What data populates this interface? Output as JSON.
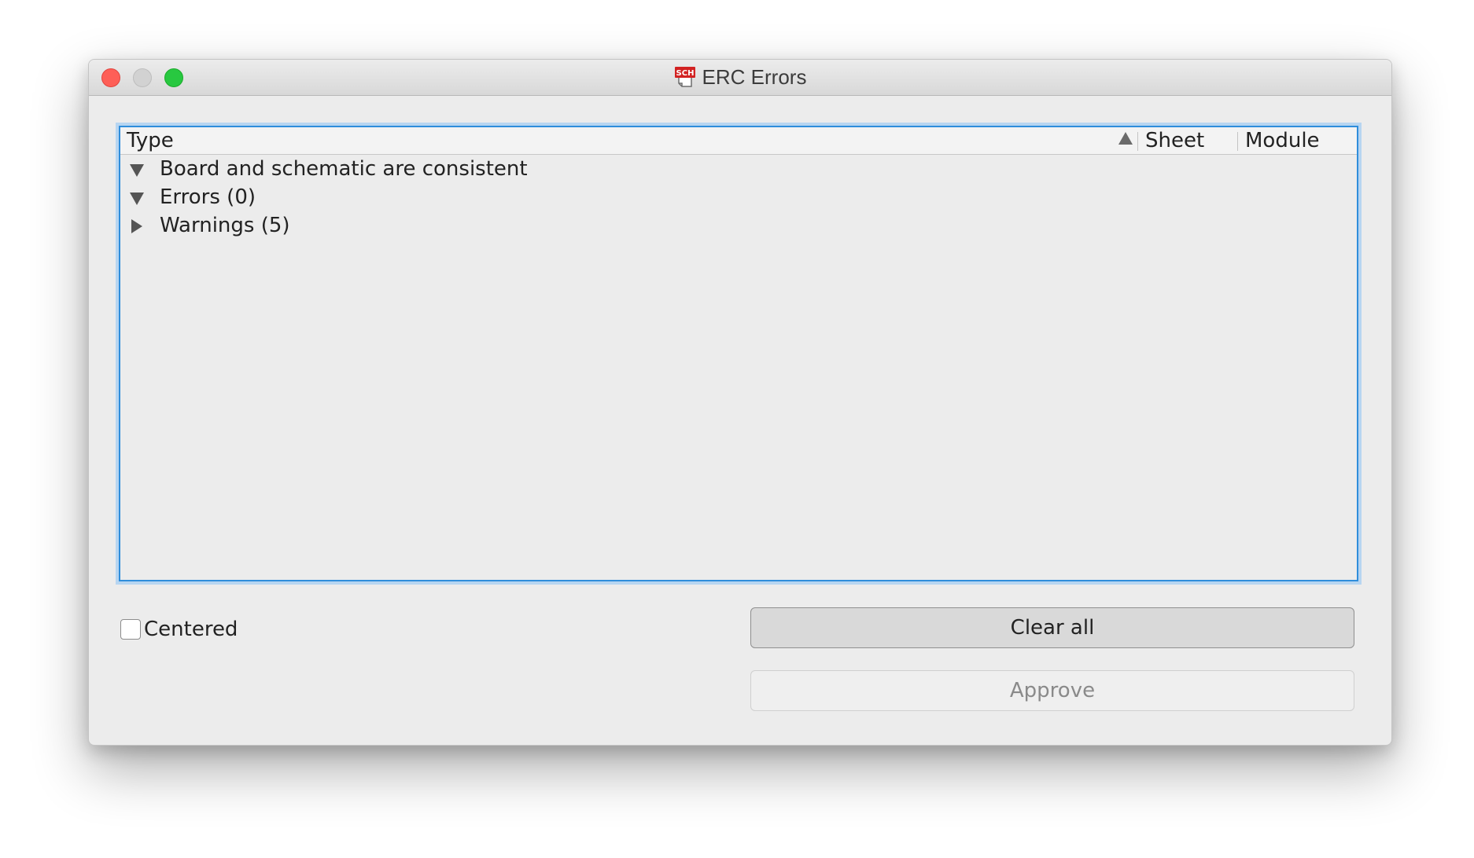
{
  "window": {
    "title": "ERC Errors",
    "app_icon": "schematic-sch-icon",
    "app_icon_text": "SCH",
    "traffic_lights": [
      "close",
      "minimize",
      "zoom"
    ]
  },
  "tree": {
    "columns": [
      "Type",
      "Sheet",
      "Module"
    ],
    "sort_column": "Type",
    "sort_direction": "ascending",
    "rows": [
      {
        "label": "Board and schematic are consistent",
        "expanded": true
      },
      {
        "label": "Errors (0)",
        "expanded": true
      },
      {
        "label": "Warnings (5)",
        "expanded": false
      }
    ]
  },
  "options": {
    "centered_label": "Centered",
    "centered_checked": false
  },
  "buttons": {
    "clear_all": "Clear all",
    "approve": "Approve",
    "approve_enabled": false
  },
  "colors": {
    "accent": "#2f8ddb",
    "close": "#fe5f57",
    "zoom": "#28c840"
  }
}
